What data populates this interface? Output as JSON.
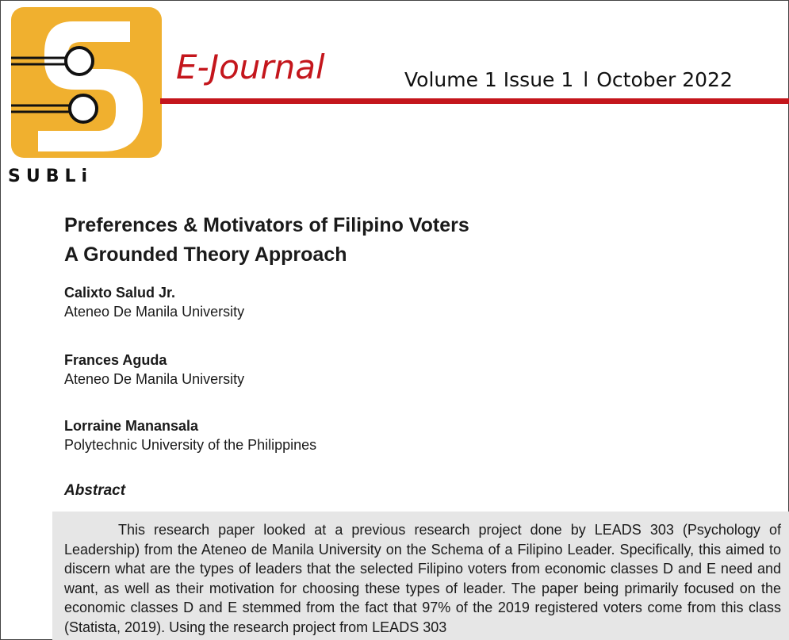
{
  "header": {
    "journal_name": "E-Journal",
    "volume": "Volume 1 Issue 1",
    "separator": "l",
    "date": "October 2022",
    "accent_color": "#c4161c"
  },
  "logo": {
    "wordmark": "SUBLi",
    "icon": "subli-logo-icon",
    "color": "#f0b02f"
  },
  "paper": {
    "title_line1": "Preferences & Motivators of Filipino Voters",
    "title_line2": "A Grounded Theory Approach"
  },
  "authors": [
    {
      "name": "Calixto Salud Jr.",
      "affiliation": "Ateneo De Manila University"
    },
    {
      "name": "Frances Aguda",
      "affiliation": "Ateneo De Manila University"
    },
    {
      "name": "Lorraine Manansala",
      "affiliation": "Polytechnic University of the Philippines"
    }
  ],
  "abstract": {
    "heading": "Abstract",
    "text": "This research paper looked at a previous research project done by LEADS 303 (Psychology of Leadership) from the Ateneo de Manila University on the Schema of a Filipino Leader. Specifically, this aimed to discern what are the types of leaders that the selected Filipino voters from economic classes D and E need and want, as well as their motivation for choosing these types of leader. The paper being primarily focused on the economic classes D and E stemmed from the fact that 97% of the 2019 registered voters come from this class (Statista, 2019). Using the research project from LEADS 303"
  }
}
